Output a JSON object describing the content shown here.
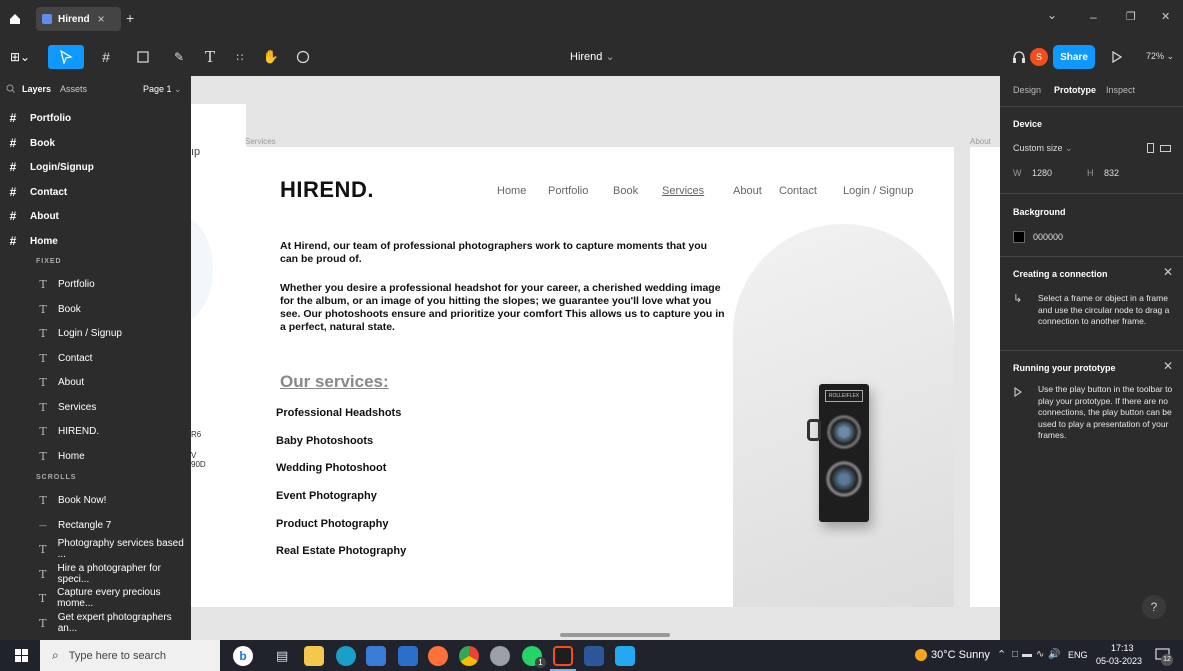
{
  "tabs": {
    "home_icon": "home-icon",
    "active_tab": "Hirend",
    "close": "×",
    "new_tab": "+"
  },
  "window": {
    "minimize": "–",
    "restore": "❐",
    "close": "✕",
    "chevron": "⌄"
  },
  "toolbar": {
    "file_title": "Hirend",
    "title_chevron": "⌄",
    "avatar_letter": "S",
    "share_label": "Share",
    "zoom": "72%"
  },
  "layers_panel": {
    "tab_layers": "Layers",
    "tab_assets": "Assets",
    "page": "Page 1",
    "frames": [
      "Portfolio",
      "Book",
      "Login/Signup",
      "Contact",
      "About",
      "Home"
    ],
    "fixed_label": "FIXED",
    "fixed_items": [
      "Portfolio",
      "Book",
      "Login / Signup",
      "Contact",
      "About",
      "Services",
      "HIREND.",
      "Home"
    ],
    "scrolls_label": "SCROLLS",
    "scroll_items": [
      {
        "icon": "text-icon",
        "label": "Book Now!"
      },
      {
        "icon": "rectangle-icon",
        "label": "Rectangle 7"
      },
      {
        "icon": "text-icon",
        "label": "Photography services based ..."
      },
      {
        "icon": "text-icon",
        "label": "Hire a photographer for speci..."
      },
      {
        "icon": "text-icon",
        "label": "Capture every precious mome..."
      },
      {
        "icon": "text-icon",
        "label": "Get expert photographers an..."
      }
    ]
  },
  "canvas": {
    "frame_label_services": "Services",
    "frame_label_about": "About",
    "left_frame_fragments": [
      "ıp",
      "R6",
      "V",
      "90D"
    ],
    "site": {
      "logo": "HIREND.",
      "nav": [
        "Home",
        "Portfolio",
        "Book",
        "Services",
        "About",
        "Contact",
        "Login / Signup"
      ],
      "intro": "At Hirend, our team of professional photographers work to capture moments that you can be proud of.",
      "body": "Whether you desire a professional headshot for your career, a cherished wedding image for the album, or an image of you hitting the slopes; we guarantee you'll love what you see. Our photoshoots ensure and prioritize your comfort This allows us to capture you in a perfect, natural state.",
      "services_heading": "Our services:",
      "services": [
        "Professional Headshots",
        "Baby Photoshoots",
        "Wedding Photoshoot",
        "Event Photography",
        "Product Photography",
        "Real Estate Photography"
      ],
      "camera_brand": "ROLLEIFLEX"
    }
  },
  "right_panel": {
    "tabs": [
      "Design",
      "Prototype",
      "Inspect"
    ],
    "device_heading": "Device",
    "device_size": "Custom size",
    "w_label": "W",
    "w_value": "1280",
    "h_label": "H",
    "h_value": "832",
    "background_heading": "Background",
    "background_value": "000000",
    "conn_heading": "Creating a connection",
    "conn_text": "Select a frame or object in a frame and use the circular node to drag a connection to another frame.",
    "run_heading": "Running your prototype",
    "run_text": "Use the play button in the toolbar to play your prototype. If there are no connections, the play button can be used to play a presentation of your frames.",
    "help": "?"
  },
  "taskbar": {
    "search_placeholder": "Type here to search",
    "weather": "30°C Sunny",
    "lang": "ENG",
    "time": "17:13",
    "date": "05-03-2023",
    "notif_count": "12",
    "whatsapp_badge": "1"
  },
  "colors": {
    "share_blue": "#0d99ff",
    "avatar_orange": "#f24e1e",
    "panel_dark": "#2c2c2c"
  }
}
